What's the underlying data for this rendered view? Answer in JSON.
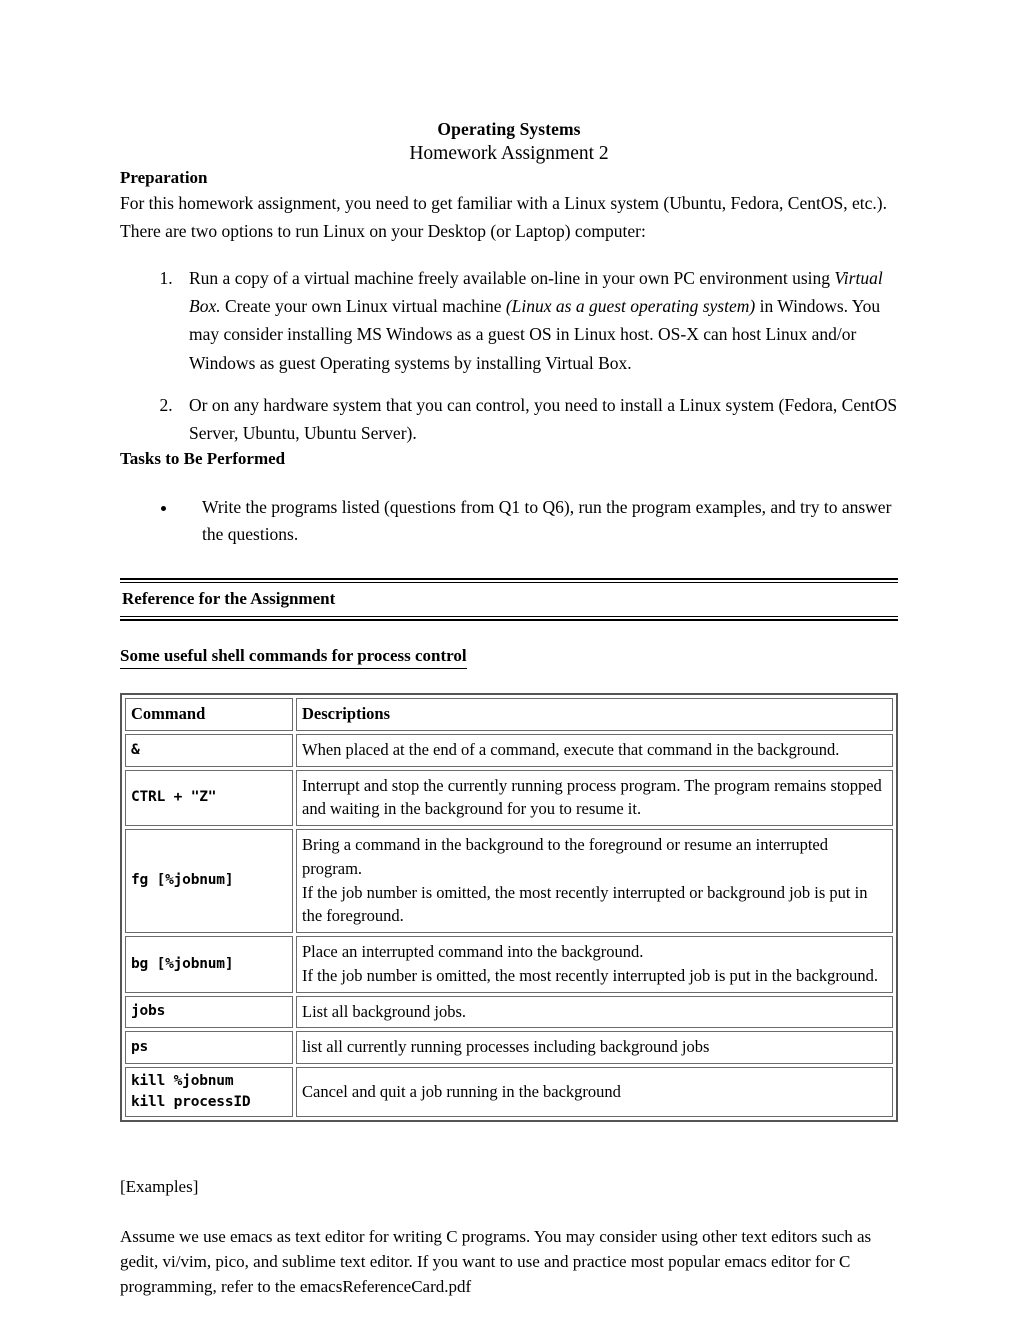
{
  "document": {
    "course": "Operating Systems",
    "title": "Homework Assignment 2"
  },
  "preparation": {
    "heading": "Preparation",
    "intro": "For this homework assignment, you need to get familiar with a Linux system (Ubuntu, Fedora, CentOS, etc.). There are two options to run Linux on your Desktop (or Laptop) computer:",
    "items": [
      {
        "part1": "Run a copy of a virtual machine freely available on-line in your own PC environment using ",
        "italic1": "Virtual Box.",
        "part2": " Create your own Linux virtual machine ",
        "italic2": "(Linux as a guest operating system)",
        "part3": " in Windows. You may consider installing MS Windows as a guest OS in Linux host. OS-X can host Linux and/or Windows as guest Operating systems by installing Virtual Box."
      },
      {
        "part1": "Or on any hardware system that you can control, you need to install a Linux system (Fedora, CentOS Server, Ubuntu, Ubuntu Server).",
        "italic1": "",
        "part2": "",
        "italic2": "",
        "part3": ""
      }
    ]
  },
  "tasks": {
    "heading": "Tasks to Be Performed",
    "bullets": [
      "Write the programs listed (questions from Q1 to Q6), run the program examples, and try to answer the questions."
    ]
  },
  "reference": {
    "heading": "Reference for the Assignment",
    "sub_heading": "Some useful shell commands for process control"
  },
  "command_table": {
    "columns": [
      "Command",
      "Descriptions"
    ],
    "rows": [
      {
        "command": "&",
        "description": "When placed at the end of a command, execute that command in the background."
      },
      {
        "command": "CTRL + \"Z\"",
        "description": "Interrupt and stop the currently running process program. The program remains stopped and waiting in the background for you to resume it."
      },
      {
        "command": "fg [%jobnum]",
        "description": "Bring a command in the background to the foreground or resume an interrupted program.\nIf the job number is omitted, the most recently interrupted or background job is put in the foreground."
      },
      {
        "command": "bg [%jobnum]",
        "description": "Place an interrupted command into the background.\nIf the job number is omitted, the most recently interrupted job is put in the background."
      },
      {
        "command": "jobs",
        "description": "List all background jobs."
      },
      {
        "command": "ps",
        "description": "list all currently running processes including background jobs"
      },
      {
        "command": "kill %jobnum\nkill processID",
        "description": "Cancel and quit a job running in the background"
      }
    ]
  },
  "examples": {
    "label": "[Examples]",
    "text": "Assume we use emacs as text editor for writing C programs. You may consider using other text editors such as gedit, vi/vim, pico, and sublime text editor. If you want to use and practice most popular emacs editor for C programming, refer to the emacsReferenceCard.pdf"
  }
}
